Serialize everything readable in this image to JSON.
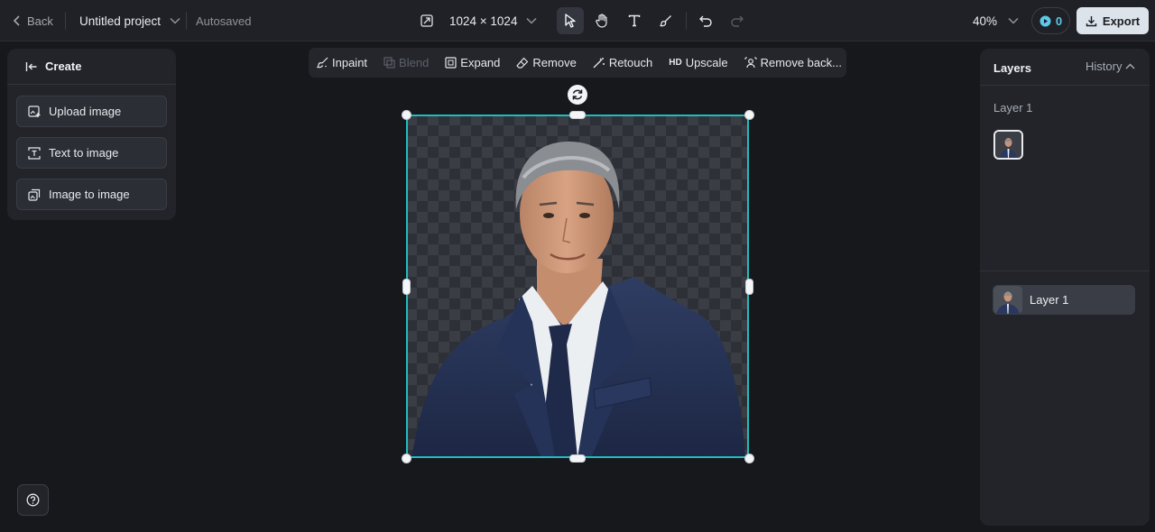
{
  "topbar": {
    "back_label": "Back",
    "project_title": "Untitled project",
    "autosave_status": "Autosaved",
    "canvas_size": "1024 × 1024",
    "zoom": "40%",
    "credits": "0",
    "export_label": "Export",
    "tools": [
      "select-tool",
      "hand-tool",
      "text-tool",
      "brush-tool",
      "undo",
      "redo"
    ]
  },
  "create_panel": {
    "title": "Create",
    "items": [
      {
        "label": "Upload image",
        "icon": "upload-image-icon"
      },
      {
        "label": "Text to image",
        "icon": "text-to-image-icon"
      },
      {
        "label": "Image to image",
        "icon": "image-to-image-icon"
      }
    ]
  },
  "edit_toolbar": {
    "items": [
      {
        "label": "Inpaint",
        "icon": "inpaint-icon",
        "disabled": false
      },
      {
        "label": "Blend",
        "icon": "blend-icon",
        "disabled": true
      },
      {
        "label": "Expand",
        "icon": "expand-icon",
        "disabled": false
      },
      {
        "label": "Remove",
        "icon": "eraser-icon",
        "disabled": false
      },
      {
        "label": "Retouch",
        "icon": "magic-wand-icon",
        "disabled": false
      },
      {
        "label": "Upscale",
        "icon": "hd-icon",
        "icon_text": "HD",
        "disabled": false
      },
      {
        "label": "Remove back...",
        "icon": "remove-background-icon",
        "disabled": false
      }
    ]
  },
  "right_panel": {
    "layers_tab": "Layers",
    "history_tab": "History",
    "group_label": "Layer 1",
    "layer_rows": [
      {
        "label": "Layer 1"
      }
    ]
  },
  "colors": {
    "accent": "#20bcc0",
    "background": "#17181c",
    "panel": "#22242a",
    "credit": "#5dc8e8"
  }
}
